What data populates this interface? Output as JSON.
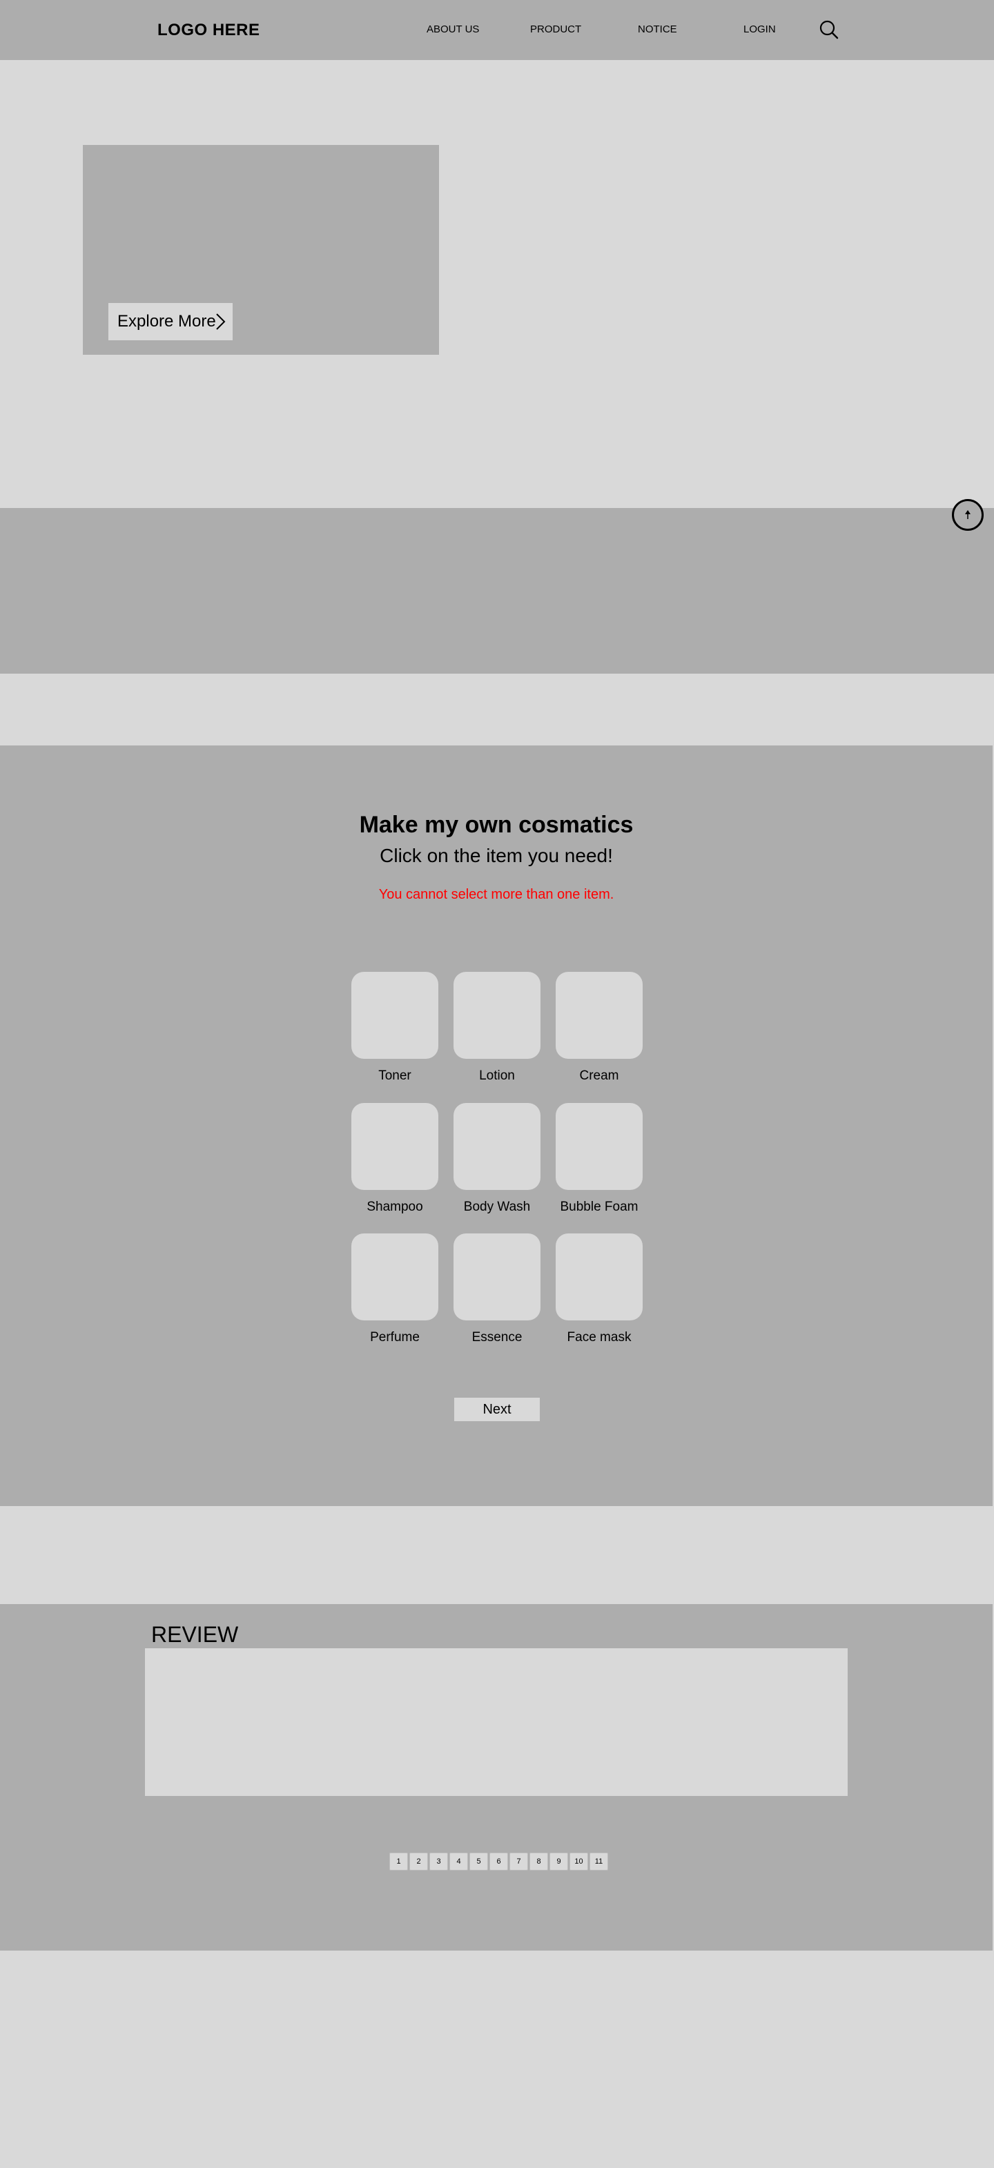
{
  "header": {
    "logo": "LOGO HERE",
    "nav": [
      "ABOUT US",
      "PRODUCT",
      "NOTICE",
      "LOGIN"
    ]
  },
  "hero": {
    "explore_label": "Explore More"
  },
  "cosmetics": {
    "title": "Make my own cosmatics",
    "subtitle": "Click on the item you need!",
    "warning": "You cannot select more than one item.",
    "items": [
      "Toner",
      "Lotion",
      "Cream",
      "Shampoo",
      "Body Wash",
      "Bubble Foam",
      "Perfume",
      "Essence",
      "Face mask"
    ],
    "next_label": "Next"
  },
  "review": {
    "title": "REVIEW",
    "pages": [
      "1",
      "2",
      "3",
      "4",
      "5",
      "6",
      "7",
      "8",
      "9",
      "10",
      "11"
    ]
  },
  "icons": {
    "search": "search-icon",
    "explore": "chevron-right-icon",
    "scroll_top": "arrow-up-icon"
  },
  "colors": {
    "background": "#d9d9d9",
    "panel": "#adadad",
    "warning": "#ff0000"
  }
}
